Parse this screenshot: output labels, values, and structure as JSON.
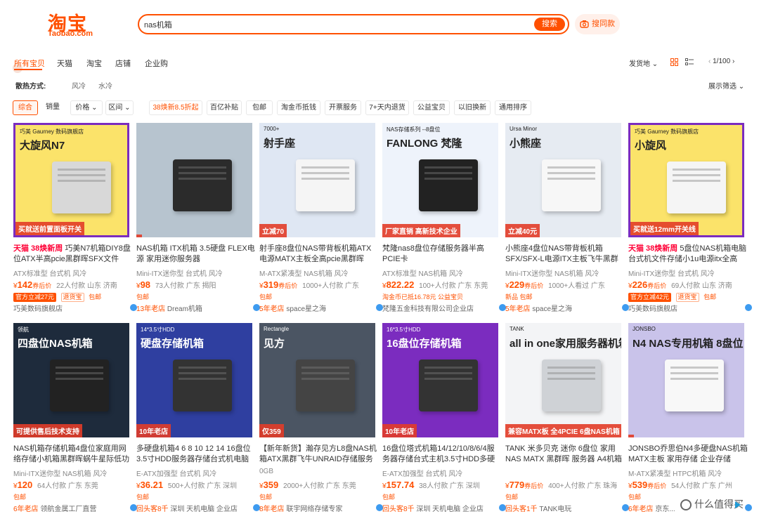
{
  "header": {
    "logo_cn": "淘宝",
    "logo_en": "Taobao.com",
    "search_value": "nas机箱",
    "search_button": "搜索",
    "photo_search": "搜同款"
  },
  "tabs": [
    "所有宝贝",
    "天猫",
    "淘宝",
    "店铺",
    "企业购"
  ],
  "right_tools": {
    "ship_from": "发货地",
    "page": "1/100",
    "display_filter": "展示筛选"
  },
  "filter": {
    "label": "散热方式:",
    "options": [
      "风冷",
      "水冷"
    ]
  },
  "sort_pills": [
    "综合",
    "销量",
    "价格",
    "区间",
    "38焕新8.5折起",
    "百亿补贴",
    "包邮",
    "淘金币抵钱",
    "开票服务",
    "7+天内退货",
    "公益宝贝",
    "以旧换新",
    "通用排序"
  ],
  "products": [
    {
      "img_title": "大旋风N7",
      "img_sub": "巧美 Gaurney 数码旗舰店",
      "img_banner": "买就送前置面板开关",
      "prefix": "天猫 38焕新周",
      "title_a": "巧美N7机箱DIY8盘位ATX半高pcie黑群晖SFX文件存…",
      "tags": "ATX标准型  台式机  风冷",
      "price": "142",
      "price_suffix": "券后价",
      "sales": "22人付款  山东 济南",
      "badge1": "官方立减27元",
      "badge2": "退货宝",
      "badge3": "包邮",
      "years": "",
      "shop": "巧美数码旗舰店"
    },
    {
      "img_title": "",
      "img_sub": "",
      "img_banner": "",
      "prefix": "",
      "title_a": "NAS机箱 ITX机箱 3.5硬盘 FLEX电源 家用迷你服务器",
      "tags": "Mini-ITX迷你型  台式机  风冷",
      "price": "98",
      "price_suffix": "",
      "sales": "73人付款  广东 揭阳",
      "badge1": "",
      "badge2": "",
      "badge3": "包邮",
      "years": "13年老店",
      "shop": "Dream机箱"
    },
    {
      "img_title": "射手座",
      "img_sub": "7000+",
      "img_banner": "立减70",
      "prefix": "",
      "title_a": "射手座8盘位NAS带背板机箱ATX电源MATX主板全高pcie黑群晖UNR…",
      "tags": "M-ATX紧凑型  NAS机箱  风冷",
      "price": "319",
      "price_suffix": "券后价",
      "sales": "1000+人付款  广东",
      "badge1": "",
      "badge2": "",
      "badge3": "包邮",
      "years": "5年老店",
      "shop": "space星之海"
    },
    {
      "img_title": "FANLONG 梵隆",
      "img_sub": "NAS存储系列 --8盘位",
      "img_banner": "厂家直销 高新技术企业",
      "prefix": "",
      "title_a": "梵隆nas8盘位存储服务器半高PCIE卡",
      "tags": "ATX标准型  NAS机箱  风冷",
      "price": "822.22",
      "price_suffix": "",
      "sales": "100+人付款  广东 东莞",
      "badge1": "",
      "badge2": "",
      "badge3": "淘金币已抵16.78元  公益宝贝",
      "years": "",
      "shop": "梵隆五金科技有限公司企业店"
    },
    {
      "img_title": "小熊座",
      "img_sub": "Ursa Minor",
      "img_banner": "立减40元",
      "prefix": "",
      "title_a": "小熊座4盘位NAS带背板机箱SFX/SFX-L电源ITX主板飞牛黑群晖UNR…",
      "tags": "Mini-ITX迷你型  NAS机箱  风冷",
      "price": "229",
      "price_suffix": "券后价",
      "sales": "1000+人看过  广东",
      "badge1": "",
      "badge2": "",
      "badge3": "新品  包邮",
      "years": "5年老店",
      "shop": "space星之海"
    },
    {
      "img_title": "小旋风",
      "img_sub": "巧美 Gaurney 数码旗舰店",
      "img_banner": "买就送12mm开关线",
      "prefix": "天猫 38焕新周",
      "title_a": "5盘位NAS机箱电脑台式机文件存储小1u电源itx全高p…",
      "tags": "Mini-ITX迷你型  台式机  风冷",
      "price": "226",
      "price_suffix": "券后价",
      "sales": "69人付款  山东 济南",
      "badge1": "官方立减42元",
      "badge2": "退货宝",
      "badge3": "包邮",
      "years": "",
      "shop": "巧美数码旗舰店"
    },
    {
      "img_title": "四盘位NAS机箱",
      "img_sub": "领航",
      "img_banner": "可提供售后技术支持",
      "prefix": "",
      "title_a": "NAS机箱存储机箱4盘位家庭用网络存储小机箱黑群晖蜗牛星际低功耗",
      "tags": "Mini-ITX迷你型  NAS机箱  风冷",
      "price": "120",
      "price_suffix": "",
      "sales": "64人付款  广东 东莞",
      "badge1": "",
      "badge2": "",
      "badge3": "包邮",
      "years": "6年老店",
      "shop": "领航金属工厂直营"
    },
    {
      "img_title": "硬盘存储机箱",
      "img_sub": "14*3.5寸HDD",
      "img_banner": "10年老店",
      "prefix": "",
      "title_a": "多硬盘机箱4 6 8 10 12 14 16盘位3.5寸HDD服务器存储台式机电脑",
      "tags": "E-ATX加强型  台式机  风冷",
      "price": "36.21",
      "price_suffix": "",
      "sales": "500+人付款  广东 深圳",
      "badge1": "",
      "badge2": "",
      "badge3": "包邮",
      "years": "回头客8千",
      "shop": "深圳 天机电脑 企业店"
    },
    {
      "img_title": "见方",
      "img_sub": "Rectangle",
      "img_banner": "仅359",
      "prefix": "",
      "title_a": "【新年新货】瀚存见方L8盘NAS机箱ATX黑群飞牛UNRAID存储服务器",
      "tags": "0GB",
      "price": "359",
      "price_suffix": "",
      "sales": "2000+人付款  广东 东莞",
      "badge1": "",
      "badge2": "",
      "badge3": "包邮",
      "years": "8年老店",
      "shop": "联宇网络存储专家"
    },
    {
      "img_title": "16盘位存储机箱",
      "img_sub": "16*3.5寸HDD",
      "img_banner": "10年老店",
      "prefix": "",
      "title_a": "16盘位塔式机箱14/12/10/8/6/4服务器存储台式主机3.5寸HDD多硬盘",
      "tags": "E-ATX加强型  台式机  风冷",
      "price": "157.74",
      "price_suffix": "",
      "sales": "38人付款  广东 深圳",
      "badge1": "",
      "badge2": "",
      "badge3": "包邮",
      "years": "回头客8千",
      "shop": "深圳 天机电脑 企业店"
    },
    {
      "img_title": "all in one家用服务器机箱",
      "img_sub": "TANK",
      "img_banner": "兼容MATX板 全4PCIE 6盘NAS机箱",
      "prefix": "",
      "title_a": "TANK 米多贝克 迷你 6盘位 家用 NAS MATX 黑群晖 服务器 A4机箱",
      "tags": "",
      "price": "779",
      "price_suffix": "券后价",
      "sales": "400+人付款  广东 珠海",
      "badge1": "",
      "badge2": "",
      "badge3": "包邮",
      "years": "回头客1千",
      "shop": "TANK电玩"
    },
    {
      "img_title": "N4 NAS专用机箱 8盘位",
      "img_sub": "JONSBO",
      "img_banner": "",
      "prefix": "",
      "title_a": "JONSBO乔思伯N4多硬盘NAS机箱MATX主板 家用存储 企业存储",
      "tags": "M-ATX紧凑型  HTPC机箱  风冷",
      "price": "539",
      "price_suffix": "券后价",
      "sales": "54人付款  广东 广州",
      "badge1": "",
      "badge2": "",
      "badge3": "包邮",
      "years": "6年老店",
      "shop": "京东..."
    }
  ],
  "watermark": "什么值得买",
  "colors": {
    "accent": "#ff5000",
    "tmall": "#ff0036"
  }
}
